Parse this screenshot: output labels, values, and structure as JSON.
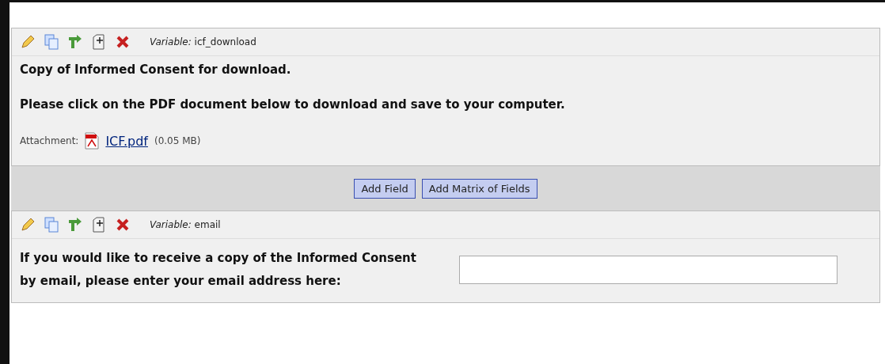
{
  "fields": [
    {
      "kind": "descriptive",
      "variable": "*Variable:* icf_download",
      "lines": [
        "Copy of Informed Consent for download.",
        "Please click on the PDF document below to download and save to your computer."
      ],
      "attachment": {
        "label": "Attachment:",
        "link": "ICF.pdf",
        "size": "(0.05 MB)"
      }
    },
    {
      "kind": "text",
      "variable": "*Variable:* email",
      "label": "If you would like to receive a copy of the Informed Consent by email, please enter your email address here:"
    }
  ],
  "buttons": [
    "Add Field",
    "Add Matrix of Fields"
  ]
}
